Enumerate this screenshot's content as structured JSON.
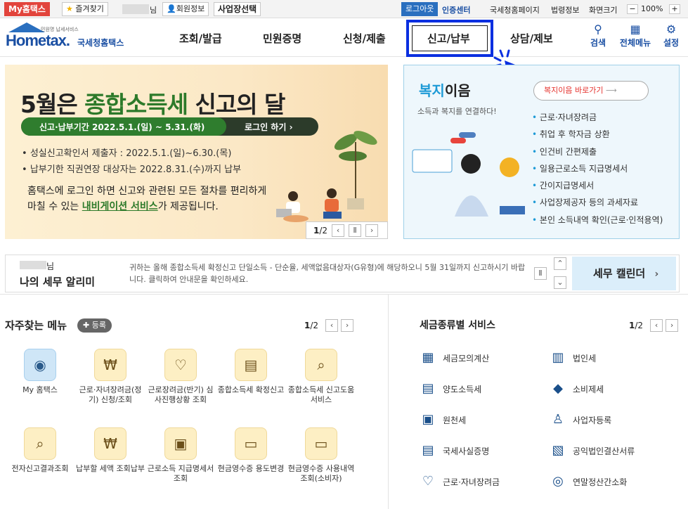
{
  "topbar": {
    "myhometax": "My홈택스",
    "favorites": "즐겨찾기",
    "user_suffix": "님",
    "member_info": "회원정보",
    "business_select": "사업장선택",
    "logout": "로그아웃",
    "cert_center": "인증센터",
    "nts_page": "국세청홈페이지",
    "law_info": "법령정보",
    "screen_size": "화면크기",
    "zoom": "100%"
  },
  "header": {
    "logo_small": "민원명 납세서비스",
    "logo_main": "Hometax.",
    "logo_sub": "국세청홈택스",
    "menu": [
      "조회/발급",
      "민원증명",
      "신청/제출",
      "신고/납부",
      "상담/제보"
    ],
    "icons": [
      {
        "label": "검색",
        "icon": "search-icon"
      },
      {
        "label": "전체메뉴",
        "icon": "grid-icon"
      },
      {
        "label": "설정",
        "icon": "gear-icon"
      }
    ]
  },
  "banner": {
    "title_pre": "5월은 ",
    "title_highlight": "종합소득세",
    "title_post": " 신고의 달",
    "period": "신고·납부기간  2022.5.1.(일) ~ 5.31.(화)",
    "login_button": "로그인 하기",
    "bullet1": "성실신고확인서 제출자 : 2022.5.1.(일)~6.30.(목)",
    "bullet2": "납부기한 직권연장 대상자는 2022.8.31.(수)까지 납부",
    "desc1": "홈택스에 로그인 하면 신고와 관련된 모든 절차를 편리하게",
    "desc2_pre": "마칠 수 있는 ",
    "desc2_link": "내비게이션 서비스",
    "desc2_post": "가 제공됩니다.",
    "page_current": "1",
    "page_total": "/2"
  },
  "welfare": {
    "title_a": "복지",
    "title_b": "이음",
    "subtitle": "소득과 복지를 연결하다!",
    "goto_button": "복지이음 바로가기",
    "items": [
      "근로·자녀장려금",
      "취업 후 학자금 상환",
      "인건비 간편제출",
      "일용근로소득 지급명세서",
      "간이지급명세서",
      "사업장제공자 등의 과세자료",
      "본인 소득내역 확인(근로·인적용역)"
    ]
  },
  "notice": {
    "user_suffix": "님",
    "title": "나의 세무 알리미",
    "message": "귀하는 올해 종합소득세 확정신고 단일소득 - 단순율, 세액없음대상자(G유형)에 해당하오니 5월 31일까지 신고하시기 바랍니다. 클릭하여 안내문을 확인하세요.",
    "calendar": "세무 캘린더"
  },
  "favorites": {
    "title": "자주찾는 메뉴",
    "register": "등록",
    "page_current": "1",
    "page_total": "/2",
    "items": [
      {
        "label": "My 홈택스",
        "icon": "user-icon"
      },
      {
        "label": "근로·자녀장려금(정기) 신청/조회",
        "icon": "money-bag-icon"
      },
      {
        "label": "근로장려금(반기) 심사진행상황 조회",
        "icon": "heart-hand-icon"
      },
      {
        "label": "종합소득세 확정신고",
        "icon": "calendar-icon"
      },
      {
        "label": "종합소득세 신고도움 서비스",
        "icon": "document-search-icon"
      },
      {
        "label": "전자신고결과조회",
        "icon": "search-doc-icon"
      },
      {
        "label": "납부할 세액 조회납부",
        "icon": "money-bag-icon"
      },
      {
        "label": "근로소득 지급명세서 조회",
        "icon": "wallet-icon"
      },
      {
        "label": "현금영수증 용도변경",
        "icon": "receipt-icon"
      },
      {
        "label": "현금영수증 사용내역조회(소비자)",
        "icon": "receipt-search-icon"
      }
    ]
  },
  "taxservices": {
    "title": "세금종류별 서비스",
    "page_current": "1",
    "page_total": "/2",
    "items": [
      {
        "label": "세금모의계산",
        "icon": "calculator-icon"
      },
      {
        "label": "법인세",
        "icon": "building-icon"
      },
      {
        "label": "양도소득세",
        "icon": "transfer-doc-icon"
      },
      {
        "label": "소비제세",
        "icon": "diamond-icon"
      },
      {
        "label": "원천세",
        "icon": "sal-doc-icon"
      },
      {
        "label": "사업자등록",
        "icon": "person-icon"
      },
      {
        "label": "국세사실증명",
        "icon": "certificate-icon"
      },
      {
        "label": "공익법인결산서류",
        "icon": "clipboard-icon"
      },
      {
        "label": "근로·자녀장려금",
        "icon": "heart-hand-icon"
      },
      {
        "label": "연말정산간소화",
        "icon": "won-hand-icon"
      }
    ]
  },
  "colors": {
    "accent": "#1a4fa3",
    "highlight_box": "#0a2fe0",
    "red": "#e5322d",
    "green": "#2d7a2a"
  }
}
